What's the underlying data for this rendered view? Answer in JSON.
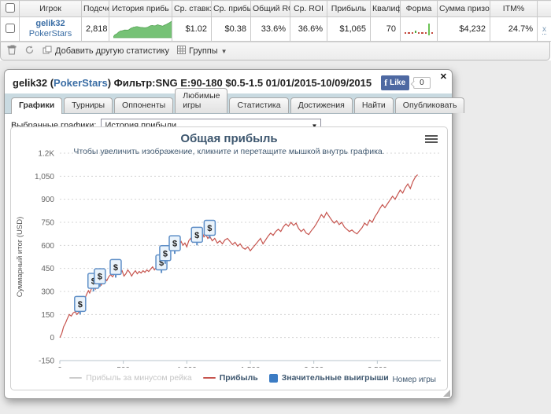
{
  "stats_table": {
    "headers": [
      "",
      "Игрок",
      "Подсчет",
      "История прибь",
      "Ср. ставк:",
      "Ср. прибь",
      "Общий ROI",
      "Ср. ROI",
      "Прибыль",
      "Квалиф",
      "Форма",
      "Сумма призо",
      "ITM%",
      ""
    ],
    "row": {
      "player_name": "gelik32",
      "player_site": "PokerStars",
      "count": "2,818",
      "avg_stake": "$1.02",
      "avg_profit": "$0.38",
      "total_roi": "33.6%",
      "avg_roi": "36.6%",
      "profit": "$1,065",
      "qualify": "70",
      "prize_sum": "$4,232",
      "itm_pct": "24.7%",
      "remove_label": "x",
      "form_items": [
        "dash",
        "dash",
        "dash",
        "dot-green",
        "dash",
        "dash",
        "dash",
        "bar-green",
        "dash"
      ],
      "form_colors": {
        "dash": "#c44a3f",
        "dot-green": "#55a944",
        "bar-green": "#6cc356"
      },
      "sparkline_color": "#76c276",
      "sparkline_stroke": "#58a558"
    }
  },
  "toolbar": {
    "add_stat_label": "Добавить другую статистику",
    "groups_label": "Группы",
    "caret_glyph": "▼"
  },
  "panel": {
    "title_player": "gelik32",
    "title_open": " (",
    "title_site": "PokerStars",
    "title_rest": ") Фильтр:SNG E:90-180 $0.5-1.5 01/01/2015-10/09/2015",
    "close_glyph": "✕",
    "fb_like_f": "f",
    "fb_like_label": "Like",
    "fb_like_count": "0",
    "tabs": [
      {
        "label": "Графики",
        "active": true
      },
      {
        "label": "Турниры",
        "active": false
      },
      {
        "label": "Оппоненты",
        "active": false
      },
      {
        "label": "Любимые игры",
        "active": false
      },
      {
        "label": "Статистика",
        "active": false
      },
      {
        "label": "Достижения",
        "active": false
      },
      {
        "label": "Найти",
        "active": false
      },
      {
        "label": "Опубликовать",
        "active": false
      }
    ],
    "select_label": "Выбранные графики:",
    "select_value": "История прибыли",
    "select_arrow": "▼"
  },
  "chart_data": {
    "type": "line",
    "title": "Общая прибыль",
    "subtitle": "Чтобы увеличить изображение, кликните и перетащите мышкой внутрь графика.",
    "xlabel": "Номер игры",
    "ylabel": "Суммарный итог (USD)",
    "xlim": [
      0,
      3000
    ],
    "ylim": [
      -150,
      1200
    ],
    "grid": true,
    "legend_position": "bottom",
    "x_ticks": [
      {
        "value": 0,
        "label": "0"
      },
      {
        "value": 500,
        "label": "500"
      },
      {
        "value": 1000,
        "label": "1,000"
      },
      {
        "value": 1500,
        "label": "1,500"
      },
      {
        "value": 2000,
        "label": "2,000"
      },
      {
        "value": 2500,
        "label": "2,500"
      }
    ],
    "y_ticks": [
      {
        "value": 1200,
        "label": "1.2K"
      },
      {
        "value": 1050,
        "label": "1,050"
      },
      {
        "value": 900,
        "label": "900"
      },
      {
        "value": 750,
        "label": "750"
      },
      {
        "value": 600,
        "label": "600"
      },
      {
        "value": 450,
        "label": "450"
      },
      {
        "value": 300,
        "label": "300"
      },
      {
        "value": 150,
        "label": "150"
      },
      {
        "value": 0,
        "label": "0"
      },
      {
        "value": -150,
        "label": "-150"
      }
    ],
    "legend": [
      {
        "label": "Прибыль за минусом рейка",
        "color": "#cccccc",
        "marker": "line",
        "disabled": true
      },
      {
        "label": "Прибыль",
        "color": "#C6544E",
        "marker": "line",
        "disabled": false
      },
      {
        "label": "Значительные выигрыши",
        "color": "#3C7CC4",
        "marker": "square",
        "disabled": false
      }
    ],
    "series": [
      {
        "name": "Прибыль",
        "color": "#C6544E",
        "points": [
          [
            0,
            0
          ],
          [
            15,
            25
          ],
          [
            30,
            70
          ],
          [
            45,
            95
          ],
          [
            60,
            125
          ],
          [
            75,
            150
          ],
          [
            90,
            140
          ],
          [
            105,
            160
          ],
          [
            120,
            168
          ],
          [
            135,
            150
          ],
          [
            150,
            165
          ],
          [
            165,
            190
          ],
          [
            180,
            215
          ],
          [
            195,
            250
          ],
          [
            210,
            280
          ],
          [
            225,
            305
          ],
          [
            235,
            290
          ],
          [
            250,
            320
          ],
          [
            265,
            335
          ],
          [
            280,
            315
          ],
          [
            295,
            345
          ],
          [
            310,
            355
          ],
          [
            325,
            340
          ],
          [
            340,
            365
          ],
          [
            355,
            385
          ],
          [
            370,
            370
          ],
          [
            385,
            395
          ],
          [
            400,
            410
          ],
          [
            415,
            395
          ],
          [
            430,
            415
          ],
          [
            445,
            430
          ],
          [
            460,
            445
          ],
          [
            475,
            420
          ],
          [
            490,
            435
          ],
          [
            505,
            400
          ],
          [
            520,
            415
          ],
          [
            535,
            440
          ],
          [
            550,
            425
          ],
          [
            565,
            400
          ],
          [
            580,
            420
          ],
          [
            595,
            435
          ],
          [
            610,
            415
          ],
          [
            625,
            430
          ],
          [
            640,
            420
          ],
          [
            655,
            435
          ],
          [
            670,
            425
          ],
          [
            685,
            440
          ],
          [
            700,
            430
          ],
          [
            715,
            445
          ],
          [
            730,
            460
          ],
          [
            745,
            440
          ],
          [
            760,
            455
          ],
          [
            775,
            500
          ],
          [
            790,
            480
          ],
          [
            805,
            510
          ],
          [
            820,
            530
          ],
          [
            835,
            555
          ],
          [
            850,
            575
          ],
          [
            865,
            600
          ],
          [
            880,
            570
          ],
          [
            895,
            585
          ],
          [
            910,
            615
          ],
          [
            925,
            590
          ],
          [
            940,
            605
          ],
          [
            955,
            625
          ],
          [
            970,
            600
          ],
          [
            985,
            615
          ],
          [
            1000,
            590
          ],
          [
            1015,
            630
          ],
          [
            1030,
            645
          ],
          [
            1045,
            620
          ],
          [
            1060,
            640
          ],
          [
            1075,
            655
          ],
          [
            1090,
            640
          ],
          [
            1105,
            665
          ],
          [
            1120,
            685
          ],
          [
            1135,
            655
          ],
          [
            1150,
            670
          ],
          [
            1165,
            645
          ],
          [
            1180,
            660
          ],
          [
            1200,
            630
          ],
          [
            1220,
            645
          ],
          [
            1240,
            615
          ],
          [
            1260,
            630
          ],
          [
            1280,
            610
          ],
          [
            1300,
            635
          ],
          [
            1320,
            645
          ],
          [
            1340,
            625
          ],
          [
            1360,
            605
          ],
          [
            1380,
            620
          ],
          [
            1400,
            595
          ],
          [
            1420,
            610
          ],
          [
            1440,
            585
          ],
          [
            1460,
            575
          ],
          [
            1480,
            590
          ],
          [
            1500,
            565
          ],
          [
            1520,
            585
          ],
          [
            1540,
            605
          ],
          [
            1560,
            625
          ],
          [
            1580,
            645
          ],
          [
            1600,
            610
          ],
          [
            1620,
            635
          ],
          [
            1640,
            660
          ],
          [
            1660,
            680
          ],
          [
            1680,
            665
          ],
          [
            1700,
            690
          ],
          [
            1720,
            705
          ],
          [
            1740,
            690
          ],
          [
            1760,
            720
          ],
          [
            1780,
            740
          ],
          [
            1800,
            725
          ],
          [
            1820,
            750
          ],
          [
            1840,
            730
          ],
          [
            1860,
            745
          ],
          [
            1880,
            710
          ],
          [
            1900,
            690
          ],
          [
            1920,
            705
          ],
          [
            1940,
            680
          ],
          [
            1960,
            670
          ],
          [
            1980,
            695
          ],
          [
            2000,
            715
          ],
          [
            2020,
            740
          ],
          [
            2040,
            770
          ],
          [
            2060,
            800
          ],
          [
            2080,
            780
          ],
          [
            2100,
            815
          ],
          [
            2120,
            790
          ],
          [
            2140,
            765
          ],
          [
            2160,
            745
          ],
          [
            2180,
            760
          ],
          [
            2200,
            735
          ],
          [
            2220,
            750
          ],
          [
            2240,
            720
          ],
          [
            2260,
            705
          ],
          [
            2280,
            690
          ],
          [
            2300,
            700
          ],
          [
            2320,
            685
          ],
          [
            2340,
            675
          ],
          [
            2360,
            695
          ],
          [
            2380,
            715
          ],
          [
            2400,
            745
          ],
          [
            2420,
            730
          ],
          [
            2440,
            765
          ],
          [
            2460,
            750
          ],
          [
            2480,
            785
          ],
          [
            2500,
            810
          ],
          [
            2520,
            840
          ],
          [
            2540,
            865
          ],
          [
            2560,
            845
          ],
          [
            2580,
            870
          ],
          [
            2600,
            895
          ],
          [
            2620,
            920
          ],
          [
            2640,
            900
          ],
          [
            2660,
            930
          ],
          [
            2680,
            960
          ],
          [
            2700,
            940
          ],
          [
            2720,
            975
          ],
          [
            2740,
            1000
          ],
          [
            2760,
            970
          ],
          [
            2780,
            1015
          ],
          [
            2800,
            1045
          ],
          [
            2818,
            1060
          ]
        ]
      }
    ],
    "significant_wins": {
      "marker_glyph": "$",
      "box_fill": "#EAF3FB",
      "box_stroke": "#5F8FC7",
      "anchors": [
        [
          160,
          150
        ],
        [
          265,
          300
        ],
        [
          315,
          330
        ],
        [
          440,
          390
        ],
        [
          800,
          420
        ],
        [
          830,
          480
        ],
        [
          905,
          545
        ],
        [
          1080,
          600
        ],
        [
          1180,
          645
        ]
      ]
    }
  }
}
